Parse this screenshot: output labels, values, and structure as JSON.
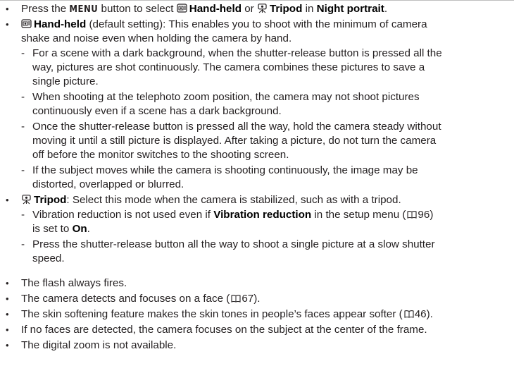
{
  "bullets": [
    {
      "pre": "Press the ",
      "menu_key": "MENU",
      "mid1": " button to select ",
      "opt1": "Hand-held",
      "mid2": " or ",
      "opt2": "Tripod",
      "mid3": " in ",
      "mode": "Night portrait",
      "post": "."
    },
    {
      "title": "Hand-held",
      "line1": " (default setting): This enables you to shoot with the minimum of camera",
      "line2": "shake and noise even when holding the camera by hand.",
      "subs": [
        {
          "lines": [
            "For a scene with a dark background, when the shutter-release button is pressed all the",
            "way, pictures are shot continuously. The camera combines these pictures to save a",
            "single picture."
          ]
        },
        {
          "lines": [
            "When shooting at the telephoto zoom position, the camera may not shoot pictures",
            "continuously even if a scene has a dark background."
          ]
        },
        {
          "lines": [
            "Once the shutter-release button is pressed all the way, hold the camera steady without",
            "moving it until a still picture is displayed. After taking a picture, do not turn the camera",
            "off before the monitor switches to the shooting screen."
          ]
        },
        {
          "lines": [
            "If the subject moves while the camera is shooting continuously, the image may be",
            "distorted, overlapped or blurred."
          ]
        }
      ]
    },
    {
      "title": "Tripod",
      "line1": ": Select this mode when the camera is stabilized, such as with a tripod.",
      "sub1_pre": "Vibration reduction is not used even if ",
      "sub1_bold": "Vibration reduction",
      "sub1_post": " in the setup menu (",
      "sub1_ref": "96",
      "sub1_end": ")",
      "sub1_line2_pre": "is set to ",
      "sub1_line2_bold": "On",
      "sub1_line2_post": ".",
      "sub2_line1": "Press the shutter-release button all the way to shoot a single picture at a slow shutter",
      "sub2_line2": "speed."
    }
  ],
  "notes": [
    {
      "pre": "The flash always fires."
    },
    {
      "pre": "The camera detects and focuses on a face (",
      "ref": "67",
      "post": ")."
    },
    {
      "pre": "The skin softening feature makes the skin tones in people’s faces appear softer (",
      "ref": "46",
      "post": ")."
    },
    {
      "pre": "If no faces are detected, the camera focuses on the subject at the center of the frame."
    },
    {
      "pre": "The digital zoom is not available."
    }
  ],
  "glyphs": {
    "bullet": "•",
    "dash": "-"
  },
  "icons": {
    "hand_held": "hand-held-night-icon",
    "tripod": "tripod-night-icon",
    "page_ref": "page-reference-book-icon"
  }
}
